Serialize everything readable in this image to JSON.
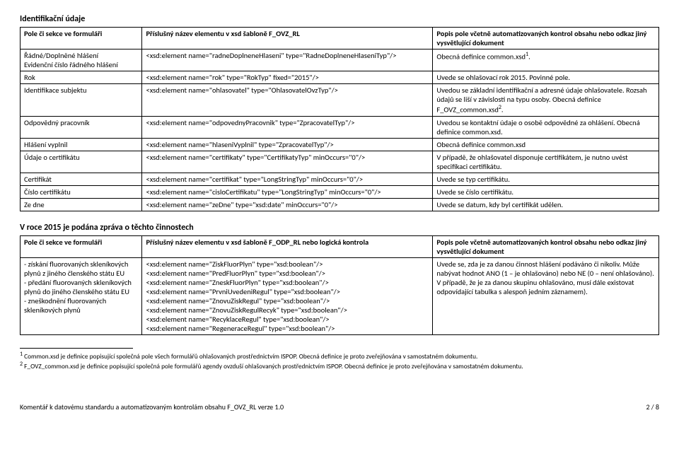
{
  "section1_title": "Identifikační údaje",
  "table1": {
    "headers": [
      "Pole či sekce ve formuláři",
      "Příslušný název elementu v xsd šabloně F_OVZ_RL",
      "Popis pole včetně automatizovaných kontrol obsahu nebo odkaz jiný vysvětlující dokument"
    ],
    "rows": [
      {
        "c1": "Řádné/Doplněné hlášení\nEvidenční číslo řádného hlášení",
        "c2": "<xsd:element name=\"radneDoplneneHlaseni\" type=\"RadneDoplneneHlaseniTyp\"/>",
        "c3_pre": "Obecná definice common.xsd",
        "c3_sup": "1",
        "c3_post": "."
      },
      {
        "c1": "Rok",
        "c2": "<xsd:element name=\"rok\" type=\"RokTyp\" fixed=\"2015\"/>",
        "c3_pre": "Uvede se ohlašovací rok 2015. Povinné pole.",
        "c3_sup": "",
        "c3_post": ""
      },
      {
        "c1": "Identifikace subjektu",
        "c2": "<xsd:element name=\"ohlasovatel\" type=\"OhlasovatelOvzTyp\"/>",
        "c3_pre": "Uvedou se základní identifikační a adresné údaje ohlašovatele. Rozsah údajů se liší v závislosti na typu osoby. Obecná definice F_OVZ_common.xsd",
        "c3_sup": "2",
        "c3_post": "."
      },
      {
        "c1": "Odpovědný pracovník",
        "c2": "<xsd:element name=\"odpovednyPracovnik\" type=\"ZpracovatelTyp\"/>",
        "c3_pre": "Uvedou se kontaktní údaje o osobě odpovědné za ohlášení. Obecná definice common.xsd.",
        "c3_sup": "",
        "c3_post": ""
      },
      {
        "c1": "Hlášení vyplnil",
        "c2": "<xsd:element name=\"hlaseniVyplnil\" type=\"ZpracovatelTyp\"/>",
        "c3_pre": "Obecná definice common.xsd",
        "c3_sup": "",
        "c3_post": ""
      },
      {
        "c1": "Údaje o certifikátu",
        "c2": "<xsd:element name=\"certifikaty\" type=\"CertifikatyTyp\" minOccurs=\"0\"/>",
        "c3_pre": "V případě, že ohlašovatel disponuje certifikátem, je nutno uvést specifikaci certifikátu.",
        "c3_sup": "",
        "c3_post": ""
      },
      {
        "c1": "Certifikát",
        "c2": "<xsd:element name=\"certifikat\" type=\"LongStringTyp\" minOccurs=\"0\"/>",
        "c3_pre": "Uvede se typ certifikátu.",
        "c3_sup": "",
        "c3_post": ""
      },
      {
        "c1": "Číslo certifikátu",
        "c2": "<xsd:element name=\"cisloCertifikatu\" type=\"LongStringTyp\" minOccurs=\"0\"/>",
        "c3_pre": "Uvede se číslo certifikátu.",
        "c3_sup": "",
        "c3_post": ""
      },
      {
        "c1": "Ze dne",
        "c2": "<xsd:element name=\"zeDne\" type=\"xsd:date\" minOccurs=\"0\"/>",
        "c3_pre": "Uvede se datum, kdy byl certifikát udělen.",
        "c3_sup": "",
        "c3_post": ""
      }
    ]
  },
  "section2_title": "V roce 2015 je podána zpráva o těchto činnostech",
  "table2": {
    "headers": [
      "Pole či sekce ve formuláři",
      "Příslušný název elementu v xsd šabloně F_ODP_RL nebo logická kontrola",
      "Popis pole včetně automatizovaných kontrol obsahu nebo odkaz jiný vysvětlující dokument"
    ],
    "rows": [
      {
        "c1": "- získání fluorovaných skleníkových plynů z jiného členského státu EU\n- předání fluorovaných skleníkových plynů do jiného členského státu EU\n- zneškodnění fluorovaných skleníkových plynů",
        "c2": "<xsd:element name=\"ZiskFluorPlyn\" type=\"xsd:boolean\"/>\n<xsd:element name=\"PredFluorPlyn\" type=\"xsd:boolean\"/>\n<xsd:element name=\"ZneskFluorPlyn\" type=\"xsd:boolean\"/>\n<xsd:element name=\"PrvniUvedeniRegul\" type=\"xsd:boolean\"/>\n<xsd:element name=\"ZnovuZiskRegul\" type=\"xsd:boolean\"/>\n<xsd:element name=\"ZnovuZiskRegulRecyk\" type=\"xsd:boolean\"/>\n<xsd:element name=\"RecyklaceRegul\" type=\"xsd:boolean\"/>\n<xsd:element name=\"RegeneraceRegul\" type=\"xsd:boolean\"/>",
        "c3": "Uvede se, zda je za danou činnost hlášení podáváno či nikoliv. Může nabývat hodnot ANO (1 – je ohlašováno) nebo NE (0 – není ohlašováno). V případě, že je za danou skupinu ohlašováno, musí dále existovat odpovídající tabulka s alespoň jedním záznamem)."
      }
    ]
  },
  "footnote1_sup": "1",
  "footnote1": " Common.xsd je definice popisující společná pole všech formulářů ohlašovaných prostřednictvím ISPOP. Obecná definice je proto zveřejňována v samostatném dokumentu.",
  "footnote2_sup": "2",
  "footnote2": " F_OVZ_common.xsd je definice popisující společná pole formulářů agendy ovzduší ohlašovaných prostřednictvím ISPOP. Obecná definice je proto zveřejňována v samostatném dokumentu.",
  "footer_left": "Komentář k datovému standardu a automatizovaným kontrolám obsahu F_OVZ_RL verze 1.0",
  "footer_right": "2 / 8"
}
